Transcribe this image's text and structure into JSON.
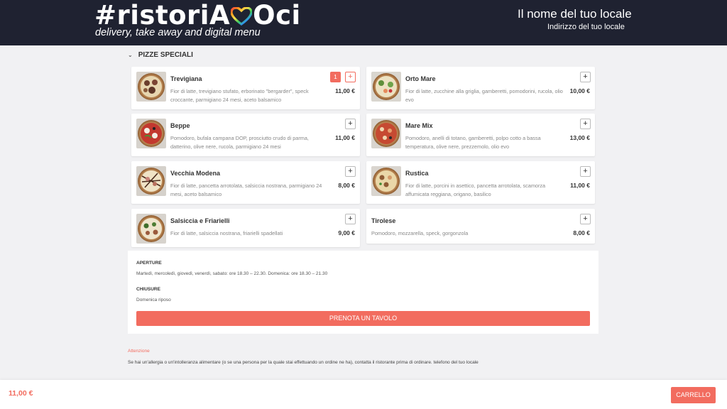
{
  "header": {
    "logo_left": "#ristoriA",
    "logo_right": "Oci",
    "tagline": "delivery, take away and digital menu",
    "venue_name": "Il nome del tuo locale",
    "venue_address": "Indirizzo del tuo locale"
  },
  "section": {
    "title": "PIZZE SPECIALI",
    "icon": "chevron-down-icon"
  },
  "items": [
    {
      "name": "Trevigiana",
      "desc": "Fior di latte, trevigiano stufato, erborinato \"bergarder\", speck croccante, parmigiano 24 mesi, aceto balsamico",
      "price": "11,00 €",
      "qty": "1",
      "add": "+"
    },
    {
      "name": "Orto Mare",
      "desc": "Fior di latte, zucchine alla griglia, gamberetti, pomodorini, rucola, olio evo",
      "price": "10,00 €",
      "add": "+"
    },
    {
      "name": "Beppe",
      "desc": "Pomodoro, bufala campana DOP, prosciutto crudo di parma, datterino, olive nere, rucola, parmigiano 24 mesi",
      "price": "11,00 €",
      "add": "+"
    },
    {
      "name": "Mare Mix",
      "desc": "Pomodoro, anelli di totano, gamberetti, polpo cotto a bassa temperatura, olive nere, prezzemolo, olio evo",
      "price": "13,00 €",
      "add": "+"
    },
    {
      "name": "Vecchia Modena",
      "desc": "Fior di latte, pancetta arrotolata, salsiccia nostrana, parmigiano 24 mesi, aceto balsamico",
      "price": "8,00 €",
      "add": "+"
    },
    {
      "name": "Rustica",
      "desc": "Fior di latte, porcini in asettico, pancetta arrotolata, scamorza affumicata reggiana, origano, basilico",
      "price": "11,00 €",
      "add": "+"
    },
    {
      "name": "Salsiccia e Friarielli",
      "desc": "Fior di latte, salsiccia nostrana, friarielli spadellati",
      "price": "9,00 €",
      "add": "+"
    },
    {
      "name": "Tirolese",
      "desc": "Pomodoro, mozzarella, speck, gorgonzola",
      "price": "8,00 €",
      "add": "+"
    }
  ],
  "info": {
    "open_label": "APERTURE",
    "open_text": "Martedì, mercoledì, giovedì, venerdì, sabato: ore 18.30 – 22.30. Domenica: ore 18.30 – 21.30",
    "closed_label": "CHIUSURE",
    "closed_text": "Domenica riposo",
    "book_button": "PRENOTA UN TAVOLO"
  },
  "notice": {
    "title": "Attenzione",
    "text": "Se hai un'allergia o un'intolleranza alimentare (o se una persona per la quale stai effettuando un ordine ne ha), contatta il ristorante prima di ordinare. telefono del tuo locale"
  },
  "footer": {
    "total": "11,00 €",
    "cart_button": "CARRELLO"
  },
  "colors": {
    "accent": "#f26c5f",
    "header_bg": "#1f2231",
    "page_bg": "#f1f1f3"
  }
}
